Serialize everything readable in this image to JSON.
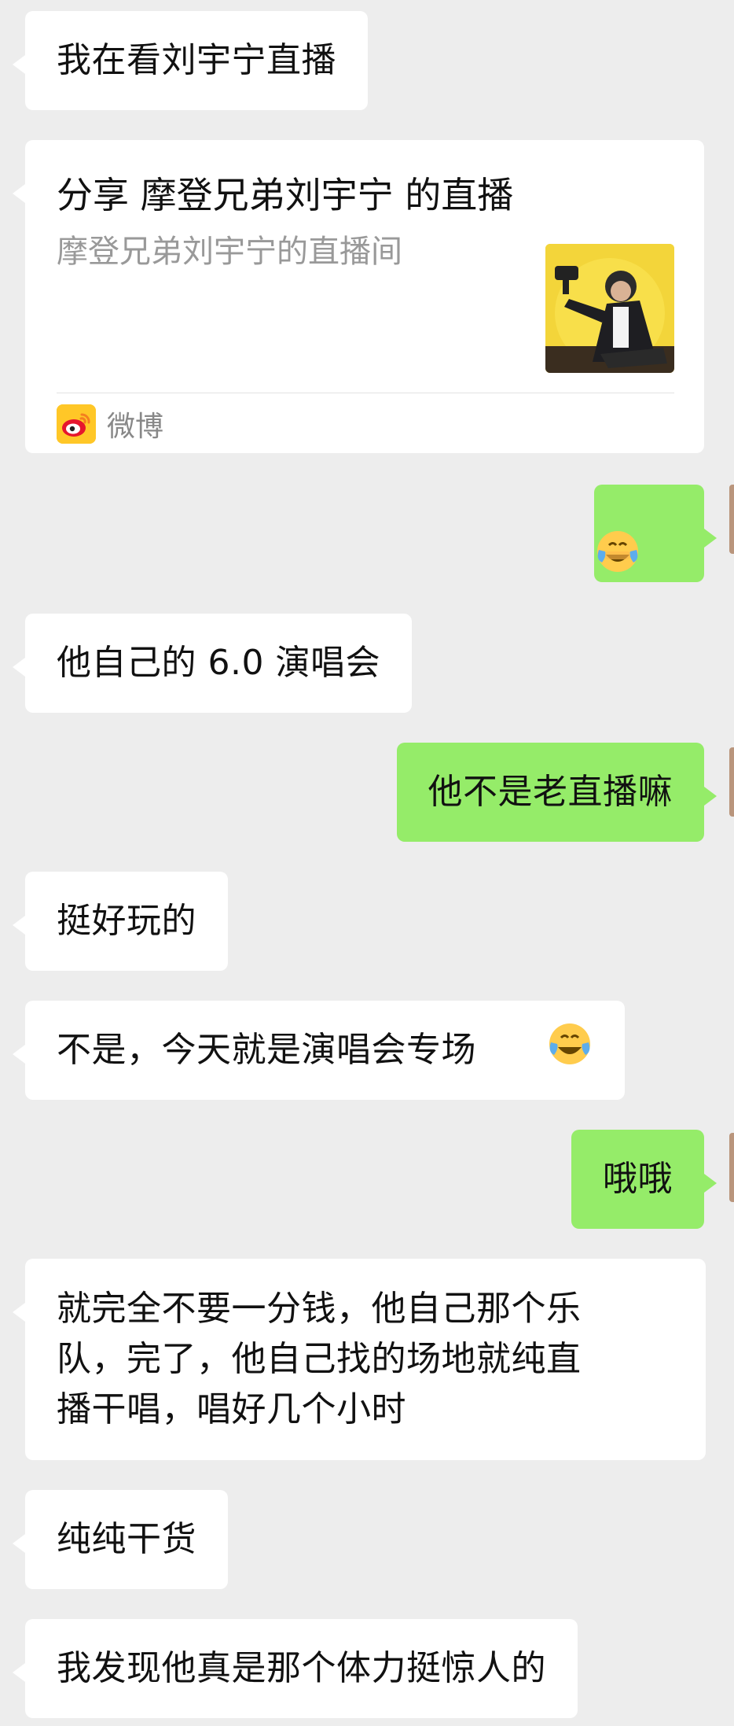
{
  "messages": [
    {
      "side": "in",
      "text": "我在看刘宇宁直播"
    },
    {
      "side": "share",
      "title": "分享 摩登兄弟刘宇宁 的直播",
      "desc": "摩登兄弟刘宇宁的直播间",
      "source": "微博",
      "thumb_icon": "singer-photo-icon",
      "source_icon": "weibo-icon"
    },
    {
      "side": "out",
      "emoji": "tears-of-joy-emoji"
    },
    {
      "side": "in",
      "text": "他自己的 6.0 演唱会"
    },
    {
      "side": "out",
      "text": "他不是老直播嘛"
    },
    {
      "side": "in",
      "text": "挺好玩的"
    },
    {
      "side": "in",
      "text": "不是，今天就是演唱会专场",
      "trailing_emoji": "tears-of-joy-emoji"
    },
    {
      "side": "out",
      "text": "哦哦"
    },
    {
      "side": "in",
      "text": "就完全不要一分钱，他自己那个乐\n队，完了，他自己找的场地就纯直\n播干唱，唱好几个小时"
    },
    {
      "side": "in",
      "text": "纯纯干货"
    },
    {
      "side": "in",
      "text": "我发现他真是那个体力挺惊人的"
    }
  ],
  "colors": {
    "background": "#ededed",
    "incoming_bubble": "#ffffff",
    "outgoing_bubble": "#95ec69",
    "secondary_text": "#999999"
  }
}
